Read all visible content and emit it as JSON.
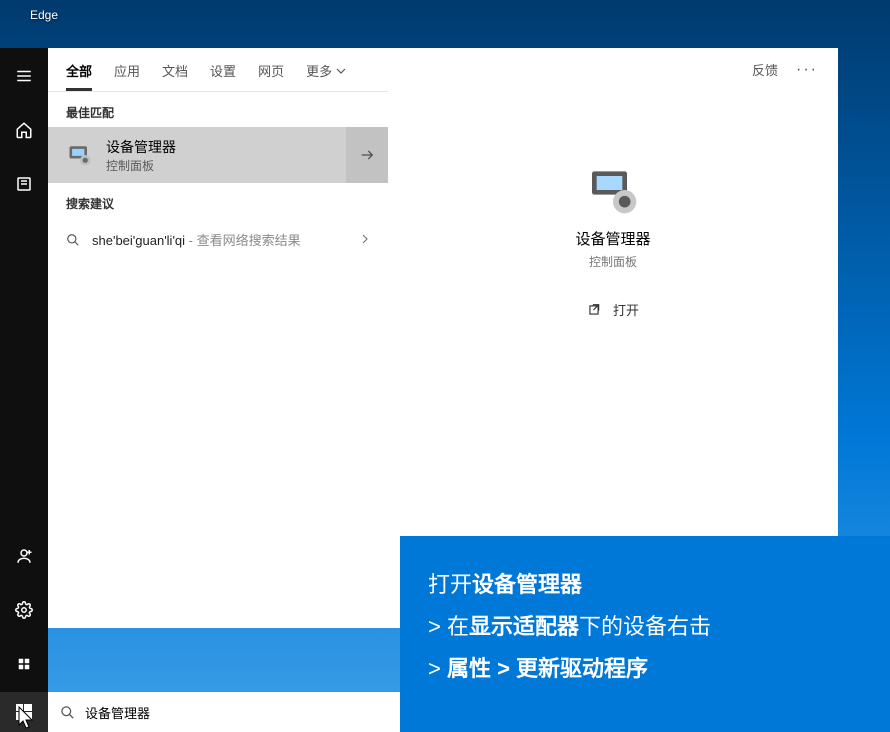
{
  "desktop": {
    "icon_label": "Edge"
  },
  "tabs": {
    "all": "全部",
    "apps": "应用",
    "docs": "文档",
    "settings": "设置",
    "web": "网页",
    "more": "更多"
  },
  "sections": {
    "best_match": "最佳匹配",
    "suggestions": "搜索建议"
  },
  "best_match": {
    "title": "设备管理器",
    "subtitle": "控制面板"
  },
  "suggestion": {
    "text": "she'bei'guan'li'qi",
    "hint": " - 查看网络搜索结果"
  },
  "right": {
    "feedback": "反馈",
    "preview_title": "设备管理器",
    "preview_subtitle": "控制面板",
    "open": "打开"
  },
  "search": {
    "value": "设备管理器"
  },
  "overlay": {
    "l1a": "打开",
    "l1b": "设备管理器",
    "l2a": "> ",
    "l2b": "在",
    "l2c": "显示适配器",
    "l2d": "下的设备右击",
    "l3a": "> ",
    "l3b": "属性 > 更新驱动程序"
  }
}
